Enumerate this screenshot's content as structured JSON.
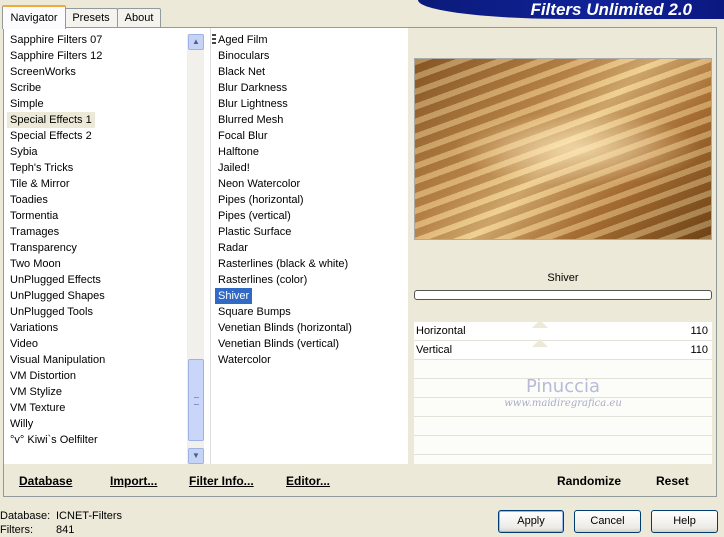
{
  "tabs": [
    "Navigator",
    "Presets",
    "About"
  ],
  "banner": "Filters Unlimited 2.0",
  "categories": [
    "Sapphire Filters 07",
    "Sapphire Filters 12",
    "ScreenWorks",
    "Scribe",
    "Simple",
    "Special Effects 1",
    "Special Effects 2",
    "Sybia",
    "Teph's Tricks",
    "Tile & Mirror",
    "Toadies",
    "Tormentia",
    "Tramages",
    "Transparency",
    "Two Moon",
    "UnPlugged Effects",
    "UnPlugged Shapes",
    "UnPlugged Tools",
    "Variations",
    "Video",
    "Visual Manipulation",
    "VM Distortion",
    "VM Stylize",
    "VM Texture",
    "Willy",
    "°v° Kiwi`s Oelfilter"
  ],
  "selected_category": "Special Effects 1",
  "filters": [
    "Aged Film",
    "Binoculars",
    "Black Net",
    "Blur Darkness",
    "Blur Lightness",
    "Blurred Mesh",
    "Focal Blur",
    "Halftone",
    "Jailed!",
    "Neon Watercolor",
    "Pipes (horizontal)",
    "Pipes (vertical)",
    "Plastic Surface",
    "Radar",
    "Rasterlines (black & white)",
    "Rasterlines (color)",
    "Shiver",
    "Square Bumps",
    "Venetian Blinds (horizontal)",
    "Venetian Blinds (vertical)",
    "Watercolor"
  ],
  "selected_filter": "Shiver",
  "filter_name": "Shiver",
  "params": [
    {
      "label": "Horizontal",
      "value": "110"
    },
    {
      "label": "Vertical",
      "value": "110"
    }
  ],
  "watermark": {
    "name": "Pinuccia",
    "url": "www.maidiregrafica.eu"
  },
  "bottom_links": {
    "database": "Database",
    "import": "Import...",
    "filter_info": "Filter Info...",
    "editor": "Editor..."
  },
  "right_links": {
    "randomize": "Randomize",
    "reset": "Reset"
  },
  "status": {
    "database_label": "Database:",
    "database_value": "ICNET-Filters",
    "filters_label": "Filters:",
    "filters_value": "841"
  },
  "buttons": {
    "apply": "Apply",
    "cancel": "Cancel",
    "help": "Help"
  }
}
